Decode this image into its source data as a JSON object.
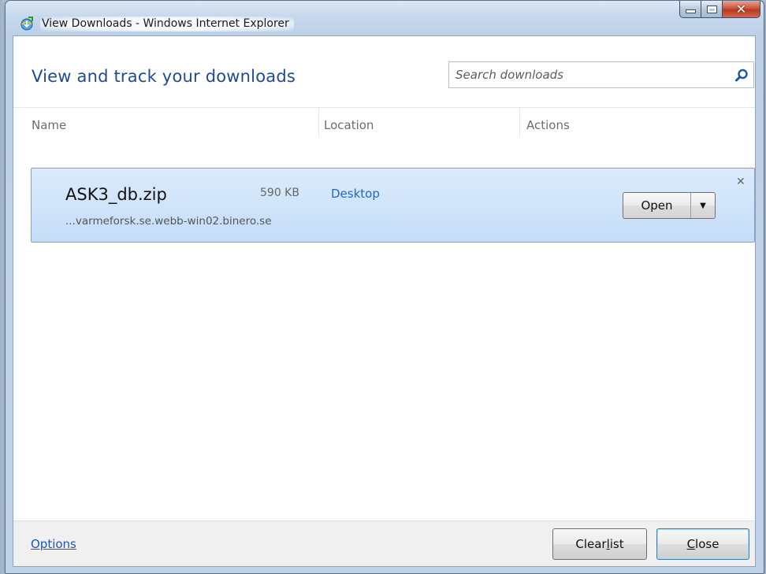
{
  "window": {
    "title": "View Downloads - Windows Internet Explorer",
    "icon": "ie-downloads-icon"
  },
  "header": {
    "title": "View and track your downloads",
    "search_placeholder": "Search downloads"
  },
  "columns": {
    "name": "Name",
    "location": "Location",
    "actions": "Actions"
  },
  "downloads": [
    {
      "file_name": "ASK3_db.zip",
      "size": "590 KB",
      "location": "Desktop",
      "source": "...varmeforsk.se.webb-win02.binero.se",
      "action_label": "Open"
    }
  ],
  "footer": {
    "options_label": "Options",
    "clear_pre": "Clear ",
    "clear_key": "l",
    "clear_post": "ist",
    "close_key": "C",
    "close_post": "lose"
  },
  "colors": {
    "accent": "#1e4a96",
    "link": "#1f69c3",
    "item_bg": "#c4ddf8"
  }
}
